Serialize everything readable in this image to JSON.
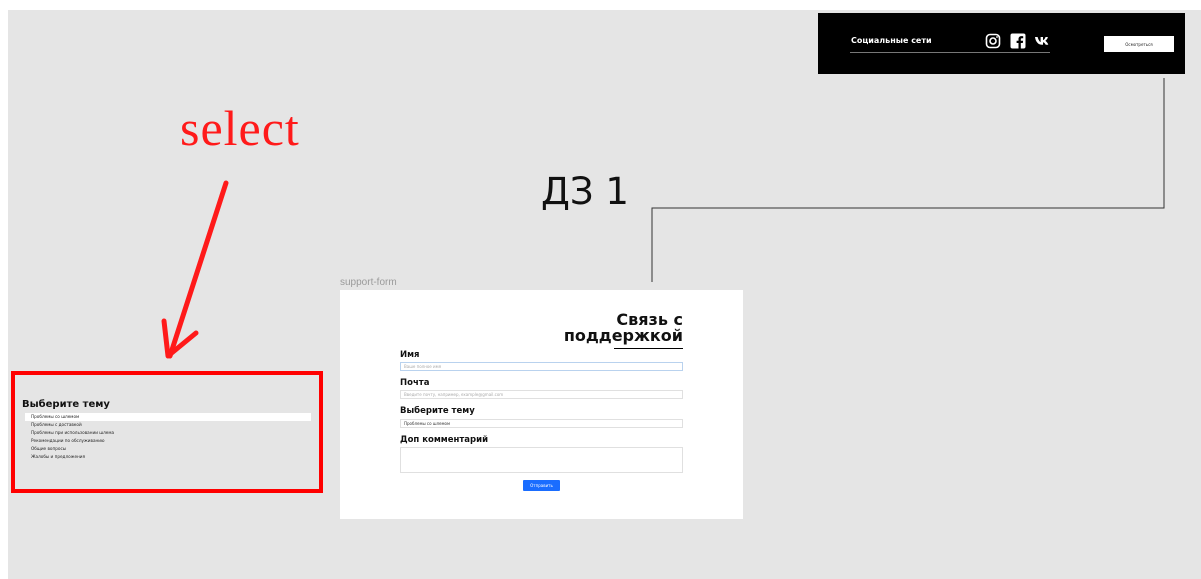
{
  "annotation": {
    "select_note": "select",
    "homework_title": "ДЗ 1"
  },
  "social": {
    "title": "Социальные сети",
    "icons": [
      "instagram-icon",
      "facebook-icon",
      "vk-icon"
    ],
    "subscribe_label": "Осмотреться"
  },
  "select_snippet": {
    "title": "Выберите тему",
    "options": [
      "Проблемы со шлемом",
      "Проблемы с доставкой",
      "Проблемы при использовании шлема",
      "Рекомендации по обслуживанию",
      "Общие вопросы",
      "Жалобы и предложения"
    ],
    "selected_index": 0
  },
  "support_form": {
    "frame_label": "support-form",
    "heading_line1": "Связь с",
    "heading_line2": "поддержкой",
    "fields": {
      "name_label": "Имя",
      "name_placeholder": "Ваше полное имя",
      "email_label": "Почта",
      "email_placeholder": "Введите почту, например, example@gmail.com",
      "topic_label": "Выберите тему",
      "topic_value": "Проблемы со шлемом",
      "comment_label": "Доп комментарий"
    },
    "submit_label": "Отправить"
  },
  "colors": {
    "canvas": "#e5e5e5",
    "annotation_red": "#ff1a1a",
    "button_blue": "#1a6dff",
    "social_bg": "#000000"
  }
}
